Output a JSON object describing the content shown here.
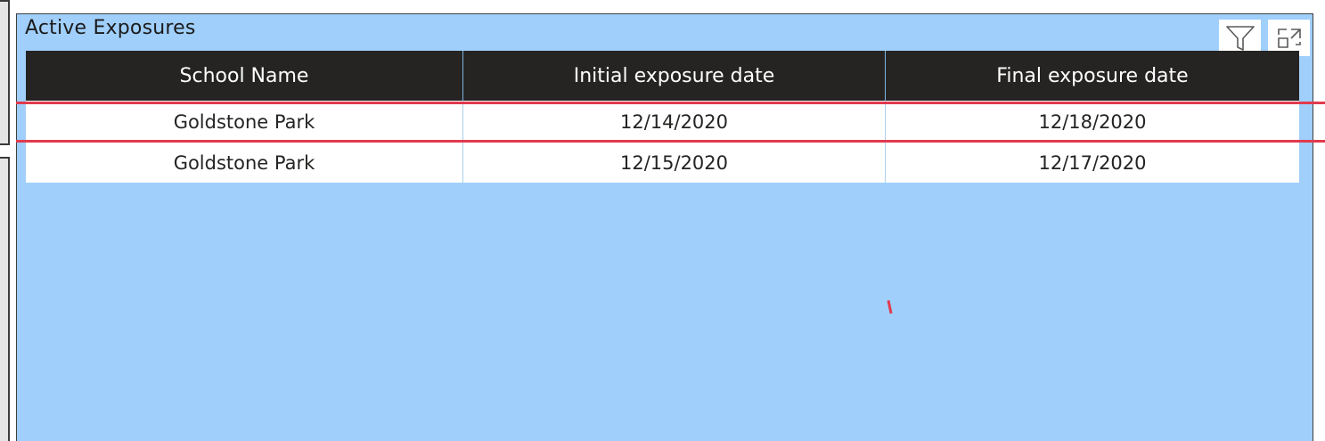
{
  "visual": {
    "title": "Active Exposures",
    "background_color": "#a0cffc",
    "icons": [
      {
        "name": "filter-icon"
      },
      {
        "name": "focus-mode-icon"
      }
    ]
  },
  "table": {
    "header_background": "#252423",
    "columns": [
      "School Name",
      "Initial exposure date",
      "Final exposure date"
    ],
    "rows": [
      [
        "Goldstone Park",
        "12/14/2020",
        "12/18/2020"
      ],
      [
        "Goldstone Park",
        "12/15/2020",
        "12/17/2020"
      ]
    ]
  },
  "highlight_color": "#e13a4d"
}
